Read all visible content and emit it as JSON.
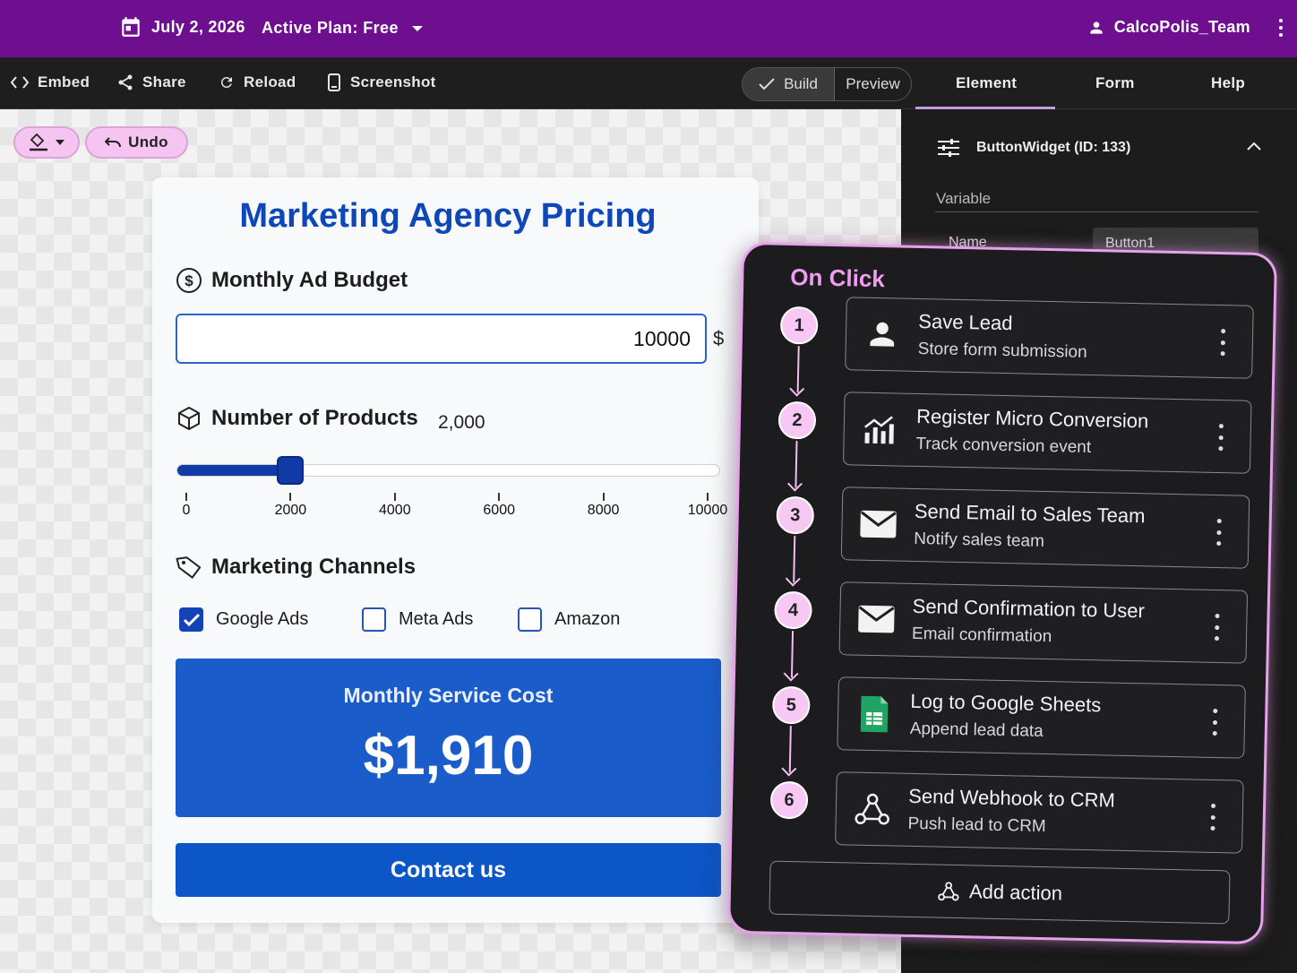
{
  "topbar": {
    "date": "July 2, 2026",
    "plan": "Active Plan: Free",
    "user": "CalcoPolis_Team"
  },
  "toolbar": {
    "embed": "Embed",
    "share": "Share",
    "reload": "Reload",
    "screenshot": "Screenshot",
    "build": "Build",
    "preview": "Preview",
    "tabs": [
      "Element",
      "Form",
      "Help"
    ]
  },
  "canvas": {
    "undo": "Undo"
  },
  "form": {
    "title": "Marketing Agency Pricing",
    "budget_label": "Monthly Ad Budget",
    "budget_value": "10000",
    "budget_unit": "$",
    "products_label": "Number of Products",
    "products_value": "2,000",
    "slider": {
      "min": 0,
      "max": 10000,
      "value": 2000,
      "ticks": [
        "0",
        "2000",
        "4000",
        "6000",
        "8000",
        "10000"
      ]
    },
    "channels_label": "Marketing Channels",
    "channels": [
      {
        "label": "Google Ads",
        "checked": true
      },
      {
        "label": "Meta Ads",
        "checked": false
      },
      {
        "label": "Amazon",
        "checked": false
      }
    ],
    "cost_label": "Monthly Service Cost",
    "cost_value": "$1,910",
    "contact": "Contact us"
  },
  "panel": {
    "widget": "ButtonWidget (ID: 133)",
    "variable": "Variable",
    "name_label": "Name",
    "name_value": "Button1"
  },
  "onclick": {
    "title": "On Click",
    "actions": [
      {
        "step": "1",
        "title": "Save Lead",
        "subtitle": "Store form submission",
        "icon": "person-icon"
      },
      {
        "step": "2",
        "title": "Register Micro Conversion",
        "subtitle": "Track conversion event",
        "icon": "chart-icon"
      },
      {
        "step": "3",
        "title": "Send Email to Sales Team",
        "subtitle": "Notify sales team",
        "icon": "mail-icon"
      },
      {
        "step": "4",
        "title": "Send Confirmation to User",
        "subtitle": "Email confirmation",
        "icon": "mail-icon"
      },
      {
        "step": "5",
        "title": "Log to Google Sheets",
        "subtitle": "Append lead data",
        "icon": "sheets-icon"
      },
      {
        "step": "6",
        "title": "Send Webhook to CRM",
        "subtitle": "Push lead to CRM",
        "icon": "webhook-icon"
      }
    ],
    "add": "Add action"
  },
  "colors": {
    "topbar": "#6e0f8f",
    "accent_blue": "#0d47b8",
    "overlay_border": "#e7a1ea"
  }
}
